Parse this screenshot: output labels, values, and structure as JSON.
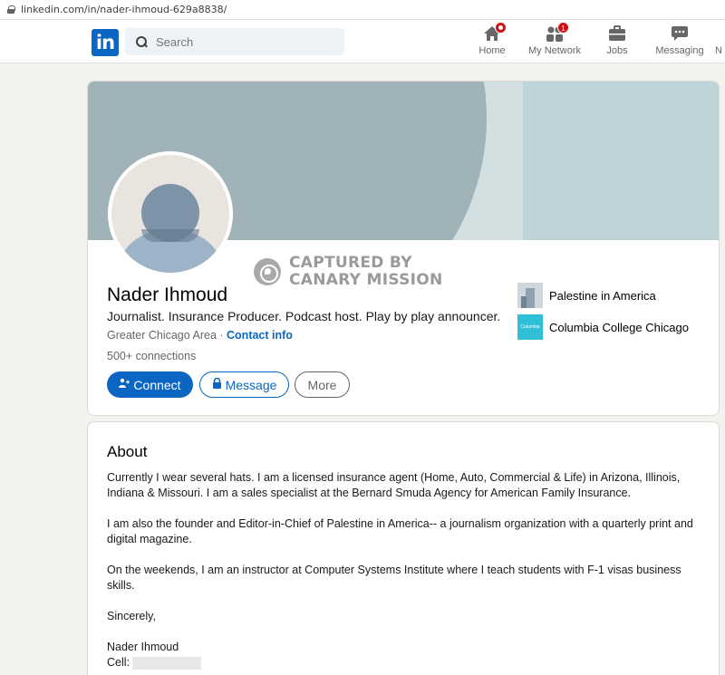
{
  "browser": {
    "url": "linkedin.com/in/nader-ihmoud-629a8838/"
  },
  "nav": {
    "logo_text": "in",
    "search_placeholder": "Search",
    "items": [
      {
        "label": "Home",
        "icon": "home-icon",
        "badge": ""
      },
      {
        "label": "My Network",
        "icon": "network-icon",
        "badge": "1"
      },
      {
        "label": "Jobs",
        "icon": "briefcase-icon",
        "badge": ""
      },
      {
        "label": "Messaging",
        "icon": "chat-icon",
        "badge": ""
      },
      {
        "label": "N",
        "icon": "bell-icon",
        "badge": ""
      }
    ],
    "accent": "#0a66c2",
    "badge_color": "#cc1016"
  },
  "profile": {
    "name": "Nader Ihmoud",
    "headline": "Journalist. Insurance Producer. Podcast host. Play by play announcer.",
    "location": "Greater Chicago Area",
    "separator": " · ",
    "contact_info": "Contact info",
    "connections": "500+ connections",
    "buttons": {
      "connect": "Connect",
      "message": "Message",
      "more": "More"
    },
    "organizations": [
      {
        "name": "Palestine in America"
      },
      {
        "name": "Columbia College Chicago",
        "logo_text": "Columbia"
      }
    ]
  },
  "watermark": {
    "line1": "CAPTURED BY",
    "line2": "CANARY MISSION"
  },
  "about": {
    "title": "About",
    "paragraphs": [
      "Currently I wear several hats. I am a licensed insurance agent (Home, Auto, Commercial & Life) in Arizona, Illinois, Indiana & Missouri. I am a sales specialist at the Bernard Smuda Agency for American Family Insurance.",
      "I am also the founder and Editor-in-Chief of Palestine in America-- a journalism organization with a quarterly print and digital magazine.",
      "On the weekends, I am an instructor at Computer Systems Institute where I teach students with F-1 visas business skills.",
      "Sincerely,"
    ],
    "signature_name": "Nader Ihmoud",
    "cell_label": "Cell:"
  }
}
